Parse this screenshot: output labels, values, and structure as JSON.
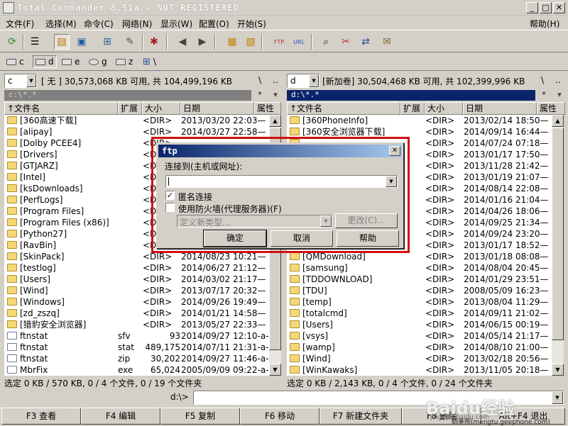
{
  "window": {
    "title": "Total Commander 8.51a - NOT REGISTERED"
  },
  "menu": [
    "文件(F)",
    "选择(M)",
    "命令(C)",
    "网络(N)",
    "显示(W)",
    "配置(O)",
    "开始(S)"
  ],
  "menu_help": "帮助(H)",
  "drives": [
    "c",
    "d",
    "e",
    "g",
    "z",
    "\\"
  ],
  "left": {
    "drive": "c",
    "info": "[ 无 ]  30,573,068 KB 可用, 共 104,499,196 KB",
    "path": "c:\\*.*",
    "headers": {
      "name": "↑文件名",
      "ext": "扩展",
      "size": "大小",
      "date": "日期",
      "attr": "属性"
    },
    "rows": [
      {
        "name": "[360高速下载]",
        "ext": "",
        "size": "<DIR>",
        "date": "2013/03/20 22:03—",
        "type": "dir"
      },
      {
        "name": "[alipay]",
        "ext": "",
        "size": "<DIR>",
        "date": "2014/03/27 22:58—",
        "type": "dir"
      },
      {
        "name": "[Dolby PCEE4]",
        "ext": "",
        "size": "<DIR>",
        "date": "",
        "type": "dir"
      },
      {
        "name": "[Drivers]",
        "ext": "",
        "size": "<DIR>",
        "date": "",
        "type": "dir"
      },
      {
        "name": "[GTJARZ]",
        "ext": "",
        "size": "<DIR>",
        "date": "",
        "type": "dir"
      },
      {
        "name": "[Intel]",
        "ext": "",
        "size": "<DIR>",
        "date": "",
        "type": "dir"
      },
      {
        "name": "[ksDownloads]",
        "ext": "",
        "size": "<DIR>",
        "date": "",
        "type": "dir"
      },
      {
        "name": "[PerfLogs]",
        "ext": "",
        "size": "<DIR>",
        "date": "",
        "type": "dir"
      },
      {
        "name": "[Program Files]",
        "ext": "",
        "size": "<DIR>",
        "date": "",
        "type": "dir"
      },
      {
        "name": "[Program Files (x86)]",
        "ext": "",
        "size": "<DIR>",
        "date": "",
        "type": "dir"
      },
      {
        "name": "[Python27]",
        "ext": "",
        "size": "<DIR>",
        "date": "",
        "type": "dir"
      },
      {
        "name": "[RavBin]",
        "ext": "",
        "size": "<DIR>",
        "date": "",
        "type": "dir"
      },
      {
        "name": "[SkinPack]",
        "ext": "",
        "size": "<DIR>",
        "date": "2014/08/23 10:21—",
        "type": "dir"
      },
      {
        "name": "[testlog]",
        "ext": "",
        "size": "<DIR>",
        "date": "2014/06/27 21:12—",
        "type": "dir"
      },
      {
        "name": "[Users]",
        "ext": "",
        "size": "<DIR>",
        "date": "2014/03/02 21:17—",
        "type": "dir"
      },
      {
        "name": "[Wind]",
        "ext": "",
        "size": "<DIR>",
        "date": "2013/07/17 20:32—",
        "type": "dir"
      },
      {
        "name": "[Windows]",
        "ext": "",
        "size": "<DIR>",
        "date": "2014/09/26 19:49—",
        "type": "dir"
      },
      {
        "name": "[zd_zszq]",
        "ext": "",
        "size": "<DIR>",
        "date": "2014/01/21 14:58—",
        "type": "dir"
      },
      {
        "name": "[猎豹安全浏览器]",
        "ext": "",
        "size": "<DIR>",
        "date": "2013/05/27 22:33—",
        "type": "dir"
      },
      {
        "name": "ftnstat",
        "ext": "sfv",
        "size": "93",
        "date": "2014/09/27 12:10-a-",
        "type": "file"
      },
      {
        "name": "ftnstat",
        "ext": "stat",
        "size": "489,175",
        "date": "2014/07/11 21:31-a-",
        "type": "file"
      },
      {
        "name": "ftnstat",
        "ext": "zip",
        "size": "30,202",
        "date": "2014/09/27 11:46-a-",
        "type": "file"
      },
      {
        "name": "MbrFix",
        "ext": "exe",
        "size": "65,024",
        "date": "2005/09/09 09:22-a-",
        "type": "file"
      }
    ],
    "status": "选定 0 KB / 570 KB, 0 / 4 个文件, 0 / 19 个文件夹"
  },
  "right": {
    "drive": "d",
    "info": "[新加卷]  30,504,468 KB 可用, 共 102,399,996 KB",
    "path": "d:\\*.*",
    "headers": {
      "name": "↑文件名",
      "ext": "扩展",
      "size": "大小",
      "date": "日期",
      "attr": "属性"
    },
    "rows": [
      {
        "name": "[360PhoneInfo]",
        "ext": "",
        "size": "<DIR>",
        "date": "2013/02/14 18:50—",
        "type": "dir"
      },
      {
        "name": "[360安全浏览器下载]",
        "ext": "",
        "size": "<DIR>",
        "date": "2014/09/14 16:44—",
        "type": "dir"
      },
      {
        "name": "",
        "ext": "",
        "size": "<DIR>",
        "date": "2014/07/24 07:18—",
        "type": "dir"
      },
      {
        "name": "",
        "ext": "",
        "size": "<DIR>",
        "date": "2013/01/17 17:50—",
        "type": "dir"
      },
      {
        "name": "",
        "ext": "",
        "size": "<DIR>",
        "date": "2013/11/28 21:42—",
        "type": "dir"
      },
      {
        "name": "",
        "ext": "",
        "size": "<DIR>",
        "date": "2013/01/19 21:07—",
        "type": "dir"
      },
      {
        "name": "",
        "ext": "",
        "size": "<DIR>",
        "date": "2014/08/14 22:08—",
        "type": "dir"
      },
      {
        "name": "",
        "ext": "",
        "size": "<DIR>",
        "date": "2014/01/16 21:04—",
        "type": "dir"
      },
      {
        "name": "",
        "ext": "",
        "size": "<DIR>",
        "date": "2014/04/26 18:06—",
        "type": "dir"
      },
      {
        "name": "",
        "ext": "",
        "size": "<DIR>",
        "date": "2014/09/25 21:34—",
        "type": "dir"
      },
      {
        "name": "",
        "ext": "",
        "size": "<DIR>",
        "date": "2014/09/24 23:20—",
        "type": "dir"
      },
      {
        "name": "",
        "ext": "",
        "size": "<DIR>",
        "date": "2013/01/17 18:52—",
        "type": "dir"
      },
      {
        "name": "[QMDownload]",
        "ext": "",
        "size": "<DIR>",
        "date": "2013/01/18 08:08—",
        "type": "dir"
      },
      {
        "name": "[samsung]",
        "ext": "",
        "size": "<DIR>",
        "date": "2014/08/04 20:45—",
        "type": "dir"
      },
      {
        "name": "[TDDOWNLOAD]",
        "ext": "",
        "size": "<DIR>",
        "date": "2014/01/29 23:51—",
        "type": "dir"
      },
      {
        "name": "[TDU]",
        "ext": "",
        "size": "<DIR>",
        "date": "2008/05/09 16:23—",
        "type": "dir"
      },
      {
        "name": "[temp]",
        "ext": "",
        "size": "<DIR>",
        "date": "2013/08/04 11:29—",
        "type": "dir"
      },
      {
        "name": "[totalcmd]",
        "ext": "",
        "size": "<DIR>",
        "date": "2014/09/11 21:02—",
        "type": "dir"
      },
      {
        "name": "[Users]",
        "ext": "",
        "size": "<DIR>",
        "date": "2014/06/15 00:19—",
        "type": "dir"
      },
      {
        "name": "[vsys]",
        "ext": "",
        "size": "<DIR>",
        "date": "2014/05/14 21:17—",
        "type": "dir"
      },
      {
        "name": "[wamp]",
        "ext": "",
        "size": "<DIR>",
        "date": "2014/08/10 21:00—",
        "type": "dir"
      },
      {
        "name": "[Wind]",
        "ext": "",
        "size": "<DIR>",
        "date": "2013/02/18 20:56—",
        "type": "dir"
      },
      {
        "name": "[WinKawaks]",
        "ext": "",
        "size": "<DIR>",
        "date": "2013/11/05 20:18—",
        "type": "dir"
      }
    ],
    "status": "选定 0 KB / 2,143 KB, 0 / 4 个文件, 0 / 24 个文件夹"
  },
  "cmdline": {
    "label": "d:\\>"
  },
  "fkeys": [
    "F3 查看",
    "F4 编辑",
    "F5 复制",
    "F6 移动",
    "F7 新建文件夹",
    "F8 删除",
    "Alt+F4 退出"
  ],
  "dialog": {
    "title": "ftp",
    "connect_label": "连接到(主机或网址):",
    "anon_label": "匿名连接",
    "anon_checked": true,
    "firewall_label": "使用防火墙(代理服务器)(F)",
    "firewall_checked": false,
    "firewall_type_placeholder": "定义新类型...",
    "change_button": "更改(C)...",
    "ok_button": "确定",
    "cancel_button": "取消",
    "help_button": "帮助"
  },
  "watermark": {
    "main": "Baidu经验",
    "url": "jingyan.baidu.com",
    "credit": "晒美图(mengtu.geephone.com)"
  }
}
